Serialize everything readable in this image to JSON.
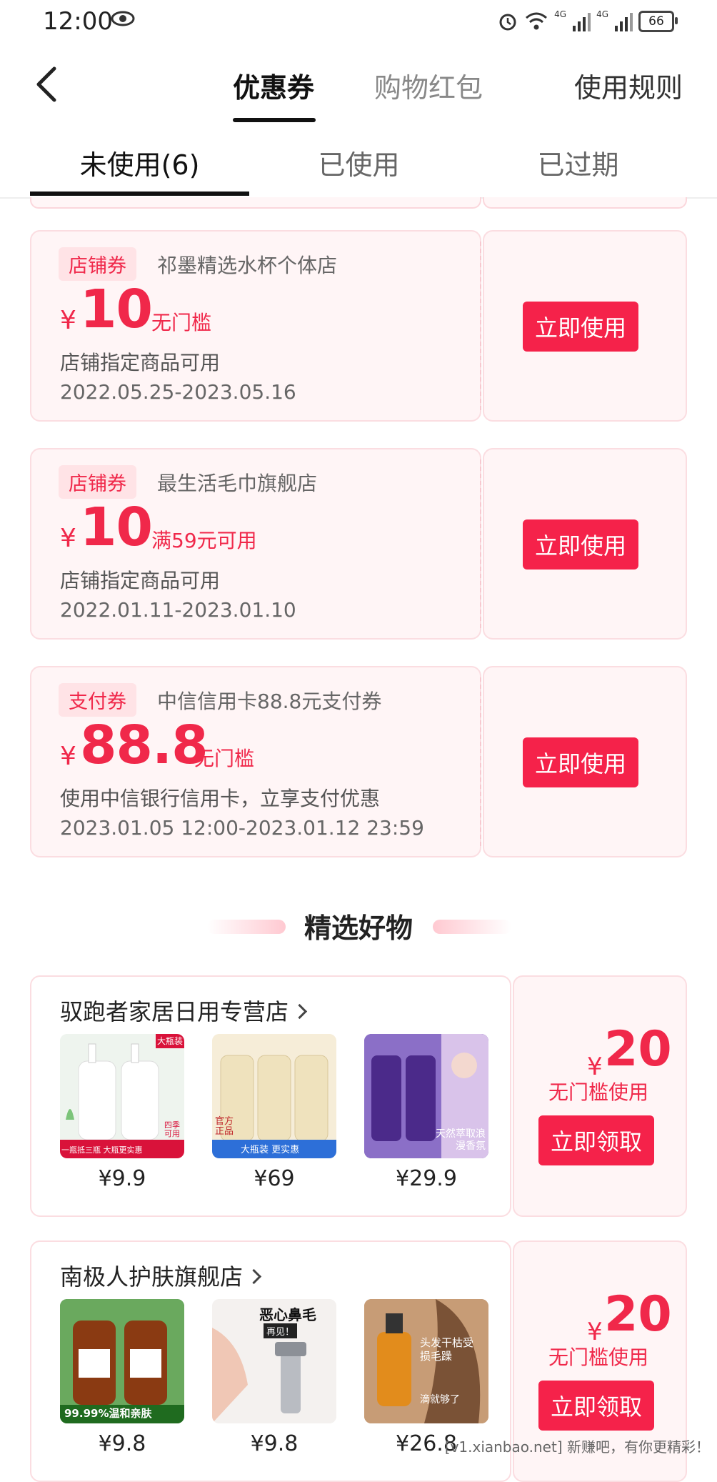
{
  "status_bar": {
    "time": "12:00",
    "battery": "66",
    "signal_labels": [
      "4G",
      "4G"
    ]
  },
  "header": {
    "tabs": [
      {
        "label": "优惠券"
      },
      {
        "label": "购物红包"
      }
    ],
    "rules_label": "使用规则"
  },
  "sub_tabs": [
    {
      "label": "未使用(6)"
    },
    {
      "label": "已使用"
    },
    {
      "label": "已过期"
    }
  ],
  "coupons": [
    {
      "tag": "店铺券",
      "shop": "祁墨精选水杯个体店",
      "currency": "¥",
      "amount": "10",
      "condition": "无门槛",
      "desc": "店铺指定商品可用",
      "date": "2022.05.25-2023.05.16",
      "button": "立即使用"
    },
    {
      "tag": "店铺券",
      "shop": "最生活毛巾旗舰店",
      "currency": "¥",
      "amount": "10",
      "condition": "满59元可用",
      "desc": "店铺指定商品可用",
      "date": "2022.01.11-2023.01.10",
      "button": "立即使用"
    },
    {
      "tag": "支付券",
      "shop": "中信信用卡88.8元支付券",
      "currency": "¥",
      "amount": "88.8",
      "condition": "无门槛",
      "desc": "使用中信银行信用卡，立享支付优惠",
      "date": "2023.01.05 12:00-2023.01.12 23:59",
      "button": "立即使用"
    }
  ],
  "section_title": "精选好物",
  "product_cards": [
    {
      "shop": "驭跑者家居日用专营店",
      "currency": "¥",
      "amount": "20",
      "condition": "无门槛使用",
      "button": "立即领取",
      "products": [
        {
          "price": "¥9.9",
          "badge_top": "大瓶装",
          "badge_bottom": "一瓶抵三瓶 大瓶更实惠",
          "badge_side": "四季可用",
          "color": "#eaf3ec"
        },
        {
          "price": "¥69",
          "badge_left": "官方正品",
          "badge_bottom": "大瓶装 更实惠",
          "color": "#f4ead2"
        },
        {
          "price": "¥29.9",
          "badge_bottom": "天然萃取浪漫香氛",
          "color": "#5b3c9c"
        }
      ]
    },
    {
      "shop": "南极人护肤旗舰店",
      "currency": "¥",
      "amount": "20",
      "condition": "无门槛使用",
      "button": "立即领取",
      "products": [
        {
          "price": "¥9.8",
          "badge_bottom": "99.99%温和亲肤",
          "color": "#3e8a3a"
        },
        {
          "price": "¥9.8",
          "badge_top": "恶心鼻毛",
          "badge_sub": "再见！",
          "color": "#f2eeec"
        },
        {
          "price": "¥26.8",
          "badge_top": "头发干枯受损毛躁",
          "badge_bottom": "滴就够了",
          "color": "#b48a66"
        }
      ]
    }
  ],
  "watermark": "[v1.xianbao.net] 新赚吧，有你更精彩！",
  "colors": {
    "accent": "#f5224a",
    "card_bg": "#fff5f6",
    "card_border": "#fbdde1"
  }
}
